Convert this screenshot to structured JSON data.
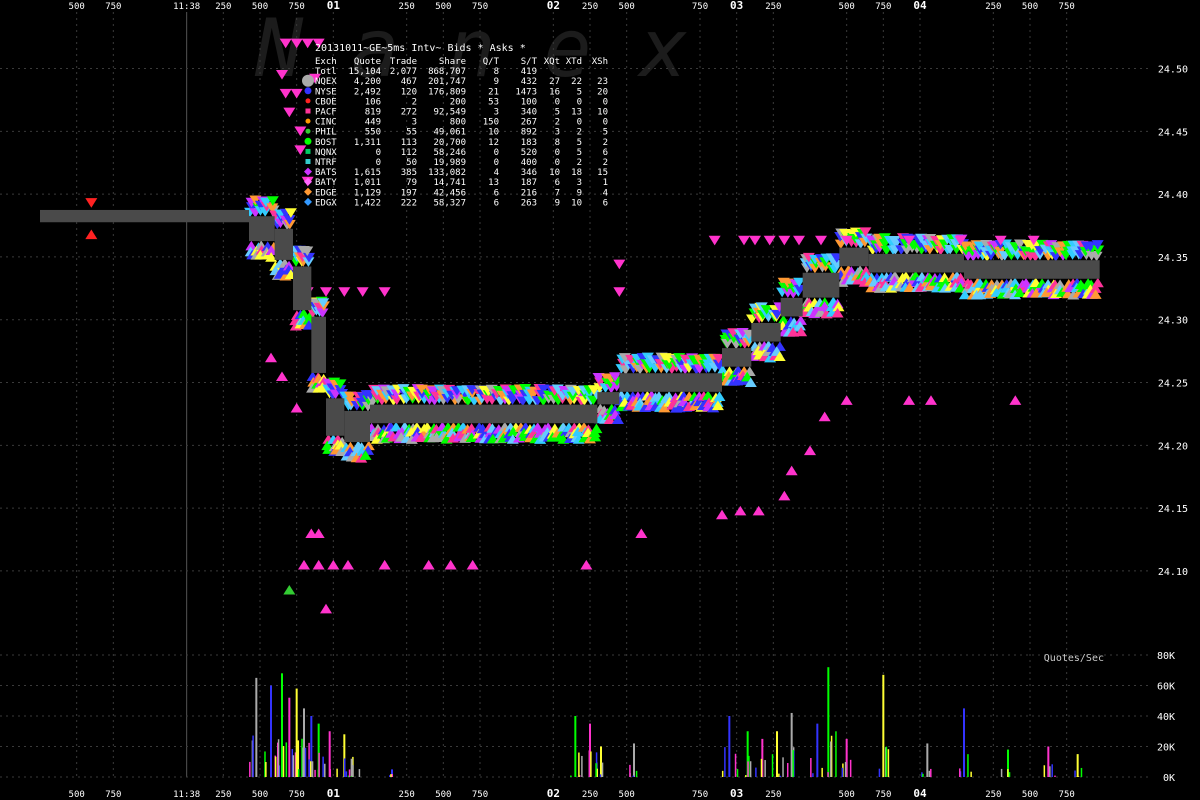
{
  "chart_data": {
    "type": "scatter",
    "title": "20131011~GE~5ms Intv~ Bids * Asks *",
    "watermark": "Nanex",
    "colors": {
      "background": "#000000",
      "grid": "#3a3a3a",
      "text": "#ffffff",
      "volume_label": "#cccccc",
      "nbbo_bar": "#4a4a4a"
    },
    "time_axis": {
      "labels_top": [
        "500",
        "750",
        "11:38",
        "250",
        "500",
        "750",
        "01",
        "250",
        "500",
        "750",
        "02",
        "250",
        "500",
        "750",
        "03",
        "250",
        "500",
        "750",
        "04",
        "250",
        "500",
        "750"
      ],
      "labels_bottom": [
        "500",
        "750",
        "11:38",
        "250",
        "500",
        "750",
        "01",
        "250",
        "500",
        "750",
        "02",
        "250",
        "500",
        "750",
        "03",
        "250",
        "500",
        "750",
        "04",
        "250",
        "500",
        "750"
      ],
      "bold_labels": [
        "01",
        "02",
        "03",
        "04"
      ],
      "ticks": [
        -5,
        -4,
        -2,
        -1,
        0,
        1,
        2,
        4,
        5,
        6,
        8,
        9,
        10,
        12,
        13,
        14,
        16,
        17,
        18,
        20,
        21,
        22
      ],
      "range": [
        -6,
        24
      ],
      "unit": "ms"
    },
    "price_axis": {
      "ticks": [
        "24.10",
        "24.15",
        "24.20",
        "24.25",
        "24.30",
        "24.35",
        "24.40",
        "24.45",
        "24.50"
      ],
      "range": [
        24.045,
        24.545
      ]
    },
    "volume_axis": {
      "label": "Quotes/Sec",
      "ticks": [
        "0K",
        "20K",
        "40K",
        "60K",
        "80K"
      ],
      "range": [
        0,
        80000
      ]
    },
    "table": {
      "columns": [
        "Exch",
        "Quote",
        "Trade",
        "Share",
        "Q/T",
        "S/T",
        "XQt",
        "XTd",
        "XSh"
      ],
      "rows": [
        {
          "cells": [
            "Totl",
            "15,104",
            "2,077",
            "868,707",
            "8",
            "419",
            "",
            "",
            ""
          ],
          "color": "#ffffff",
          "marker": "none"
        },
        {
          "cells": [
            "NQEX",
            "4,200",
            "467",
            "201,747",
            "9",
            "432",
            "27",
            "22",
            "23"
          ],
          "color": "#aaaaaa",
          "marker": "circle-large"
        },
        {
          "cells": [
            "NYSE",
            "2,492",
            "120",
            "176,809",
            "21",
            "1473",
            "16",
            "5",
            "20"
          ],
          "color": "#3333ff",
          "marker": "circle"
        },
        {
          "cells": [
            "CBOE",
            "106",
            "2",
            "200",
            "53",
            "100",
            "0",
            "0",
            "0"
          ],
          "color": "#ff2222",
          "marker": "circle-small"
        },
        {
          "cells": [
            "PACF",
            "819",
            "272",
            "92,549",
            "3",
            "340",
            "5",
            "13",
            "10"
          ],
          "color": "#ff3399",
          "marker": "square"
        },
        {
          "cells": [
            "CINC",
            "449",
            "3",
            "800",
            "150",
            "267",
            "2",
            "0",
            "0"
          ],
          "color": "#ff9900",
          "marker": "circle-small"
        },
        {
          "cells": [
            "PHIL",
            "550",
            "55",
            "49,061",
            "10",
            "892",
            "3",
            "2",
            "5"
          ],
          "color": "#33cc33",
          "marker": "circle-small"
        },
        {
          "cells": [
            "BOST",
            "1,311",
            "113",
            "20,700",
            "12",
            "183",
            "8",
            "5",
            "2"
          ],
          "color": "#00ff00",
          "marker": "circle"
        },
        {
          "cells": [
            "NQNX",
            "0",
            "112",
            "58,246",
            "0",
            "520",
            "0",
            "5",
            "6"
          ],
          "color": "#00cc66",
          "marker": "square"
        },
        {
          "cells": [
            "NTRF",
            "0",
            "50",
            "19,989",
            "0",
            "400",
            "0",
            "2",
            "2"
          ],
          "color": "#33cccc",
          "marker": "square"
        },
        {
          "cells": [
            "BATS",
            "1,615",
            "385",
            "133,082",
            "4",
            "346",
            "10",
            "18",
            "15"
          ],
          "color": "#cc33ff",
          "marker": "diamond"
        },
        {
          "cells": [
            "BATY",
            "1,011",
            "79",
            "14,741",
            "13",
            "187",
            "6",
            "3",
            "1"
          ],
          "color": "#ff66ff",
          "marker": "diamond"
        },
        {
          "cells": [
            "EDGE",
            "1,129",
            "197",
            "42,456",
            "6",
            "216",
            "7",
            "9",
            "4"
          ],
          "color": "#ff9933",
          "marker": "diamond"
        },
        {
          "cells": [
            "EDGX",
            "1,422",
            "222",
            "58,327",
            "6",
            "263",
            "9",
            "10",
            "6"
          ],
          "color": "#3399ff",
          "marker": "diamond"
        }
      ]
    },
    "nbbo_steps": [
      {
        "t0": -6.0,
        "t1": -0.3,
        "bid": 24.38,
        "ask": 24.385
      },
      {
        "t0": -0.3,
        "t1": 0.4,
        "bid": 24.365,
        "ask": 24.38
      },
      {
        "t0": 0.4,
        "t1": 0.9,
        "bid": 24.35,
        "ask": 24.37
      },
      {
        "t0": 0.9,
        "t1": 1.4,
        "bid": 24.31,
        "ask": 24.34
      },
      {
        "t0": 1.4,
        "t1": 1.8,
        "bid": 24.26,
        "ask": 24.3
      },
      {
        "t0": 1.8,
        "t1": 2.3,
        "bid": 24.21,
        "ask": 24.235
      },
      {
        "t0": 2.3,
        "t1": 3.0,
        "bid": 24.205,
        "ask": 24.225
      },
      {
        "t0": 3.0,
        "t1": 9.2,
        "bid": 24.22,
        "ask": 24.23
      },
      {
        "t0": 9.2,
        "t1": 9.8,
        "bid": 24.235,
        "ask": 24.24
      },
      {
        "t0": 9.8,
        "t1": 12.6,
        "bid": 24.245,
        "ask": 24.255
      },
      {
        "t0": 12.6,
        "t1": 13.4,
        "bid": 24.265,
        "ask": 24.275
      },
      {
        "t0": 13.4,
        "t1": 14.2,
        "bid": 24.285,
        "ask": 24.295
      },
      {
        "t0": 14.2,
        "t1": 14.8,
        "bid": 24.305,
        "ask": 24.315
      },
      {
        "t0": 14.8,
        "t1": 15.8,
        "bid": 24.32,
        "ask": 24.335
      },
      {
        "t0": 15.8,
        "t1": 16.6,
        "bid": 24.345,
        "ask": 24.355
      },
      {
        "t0": 16.6,
        "t1": 19.2,
        "bid": 24.34,
        "ask": 24.35
      },
      {
        "t0": 19.2,
        "t1": 22.9,
        "bid": 24.335,
        "ask": 24.345
      }
    ],
    "quote_points": [
      {
        "t": -4.6,
        "p": 24.393,
        "dir": "down",
        "color": "#ff2222"
      },
      {
        "t": -4.6,
        "p": 24.368,
        "dir": "up",
        "color": "#ff2222"
      },
      {
        "t": 0.7,
        "p": 24.52,
        "dir": "down",
        "color": "#ff33cc"
      },
      {
        "t": 1.0,
        "p": 24.52,
        "dir": "down",
        "color": "#ff33cc"
      },
      {
        "t": 1.3,
        "p": 24.52,
        "dir": "down",
        "color": "#ff33cc"
      },
      {
        "t": 1.6,
        "p": 24.52,
        "dir": "down",
        "color": "#ff33cc"
      },
      {
        "t": 0.6,
        "p": 24.495,
        "dir": "down",
        "color": "#ff33cc"
      },
      {
        "t": 1.5,
        "p": 24.492,
        "dir": "down",
        "color": "#ff33cc"
      },
      {
        "t": 0.7,
        "p": 24.48,
        "dir": "down",
        "color": "#ff33cc"
      },
      {
        "t": 1.0,
        "p": 24.48,
        "dir": "down",
        "color": "#ff33cc"
      },
      {
        "t": 0.8,
        "p": 24.465,
        "dir": "down",
        "color": "#ff33cc"
      },
      {
        "t": 1.1,
        "p": 24.45,
        "dir": "down",
        "color": "#ff33cc"
      },
      {
        "t": 1.1,
        "p": 24.435,
        "dir": "down",
        "color": "#ff33cc"
      },
      {
        "t": 1.3,
        "p": 24.41,
        "dir": "down",
        "color": "#ff33cc"
      },
      {
        "t": 1.2,
        "p": 24.322,
        "dir": "down",
        "color": "#ff33cc"
      },
      {
        "t": 1.3,
        "p": 24.322,
        "dir": "down",
        "color": "#ff33cc"
      },
      {
        "t": 1.8,
        "p": 24.322,
        "dir": "down",
        "color": "#ff33cc"
      },
      {
        "t": 2.3,
        "p": 24.322,
        "dir": "down",
        "color": "#ff33cc"
      },
      {
        "t": 2.8,
        "p": 24.322,
        "dir": "down",
        "color": "#ff33cc"
      },
      {
        "t": 3.4,
        "p": 24.322,
        "dir": "down",
        "color": "#ff33cc"
      },
      {
        "t": 9.8,
        "p": 24.322,
        "dir": "down",
        "color": "#ff33cc"
      },
      {
        "t": 9.8,
        "p": 24.344,
        "dir": "down",
        "color": "#ff33cc"
      },
      {
        "t": 12.4,
        "p": 24.363,
        "dir": "down",
        "color": "#ff33cc"
      },
      {
        "t": 13.2,
        "p": 24.363,
        "dir": "down",
        "color": "#ff33cc"
      },
      {
        "t": 13.5,
        "p": 24.363,
        "dir": "down",
        "color": "#ff33cc"
      },
      {
        "t": 13.9,
        "p": 24.363,
        "dir": "down",
        "color": "#ff33cc"
      },
      {
        "t": 14.3,
        "p": 24.363,
        "dir": "down",
        "color": "#ff33cc"
      },
      {
        "t": 14.7,
        "p": 24.363,
        "dir": "down",
        "color": "#ff33cc"
      },
      {
        "t": 15.3,
        "p": 24.363,
        "dir": "down",
        "color": "#ff33cc"
      },
      {
        "t": 16.0,
        "p": 24.363,
        "dir": "down",
        "color": "#ff33cc"
      },
      {
        "t": 17.7,
        "p": 24.363,
        "dir": "down",
        "color": "#ff33cc"
      },
      {
        "t": 19.1,
        "p": 24.363,
        "dir": "down",
        "color": "#ff33cc"
      },
      {
        "t": 20.2,
        "p": 24.363,
        "dir": "down",
        "color": "#ff33cc"
      },
      {
        "t": 21.1,
        "p": 24.363,
        "dir": "down",
        "color": "#ff33cc"
      },
      {
        "t": 0.3,
        "p": 24.27,
        "dir": "up",
        "color": "#ff33cc"
      },
      {
        "t": 0.6,
        "p": 24.255,
        "dir": "up",
        "color": "#ff33cc"
      },
      {
        "t": 1.0,
        "p": 24.23,
        "dir": "up",
        "color": "#ff33cc"
      },
      {
        "t": 1.4,
        "p": 24.13,
        "dir": "up",
        "color": "#ff33cc"
      },
      {
        "t": 1.6,
        "p": 24.13,
        "dir": "up",
        "color": "#ff33cc"
      },
      {
        "t": 1.2,
        "p": 24.105,
        "dir": "up",
        "color": "#ff33cc"
      },
      {
        "t": 1.6,
        "p": 24.105,
        "dir": "up",
        "color": "#ff33cc"
      },
      {
        "t": 2.0,
        "p": 24.105,
        "dir": "up",
        "color": "#ff33cc"
      },
      {
        "t": 2.4,
        "p": 24.105,
        "dir": "up",
        "color": "#ff33cc"
      },
      {
        "t": 3.4,
        "p": 24.105,
        "dir": "up",
        "color": "#ff33cc"
      },
      {
        "t": 4.6,
        "p": 24.105,
        "dir": "up",
        "color": "#ff33cc"
      },
      {
        "t": 5.2,
        "p": 24.105,
        "dir": "up",
        "color": "#ff33cc"
      },
      {
        "t": 5.8,
        "p": 24.105,
        "dir": "up",
        "color": "#ff33cc"
      },
      {
        "t": 8.9,
        "p": 24.105,
        "dir": "up",
        "color": "#ff33cc"
      },
      {
        "t": 10.4,
        "p": 24.13,
        "dir": "up",
        "color": "#ff33cc"
      },
      {
        "t": 1.8,
        "p": 24.07,
        "dir": "up",
        "color": "#ff33cc"
      },
      {
        "t": 0.8,
        "p": 24.085,
        "dir": "up",
        "color": "#33cc33"
      },
      {
        "t": 12.6,
        "p": 24.145,
        "dir": "up",
        "color": "#ff33cc"
      },
      {
        "t": 13.1,
        "p": 24.148,
        "dir": "up",
        "color": "#ff33cc"
      },
      {
        "t": 13.6,
        "p": 24.148,
        "dir": "up",
        "color": "#ff33cc"
      },
      {
        "t": 14.3,
        "p": 24.16,
        "dir": "up",
        "color": "#ff33cc"
      },
      {
        "t": 14.5,
        "p": 24.18,
        "dir": "up",
        "color": "#ff33cc"
      },
      {
        "t": 15.0,
        "p": 24.196,
        "dir": "up",
        "color": "#ff33cc"
      },
      {
        "t": 15.4,
        "p": 24.223,
        "dir": "up",
        "color": "#ff33cc"
      },
      {
        "t": 16.0,
        "p": 24.236,
        "dir": "up",
        "color": "#ff33cc"
      },
      {
        "t": 17.7,
        "p": 24.236,
        "dir": "up",
        "color": "#ff33cc"
      },
      {
        "t": 18.3,
        "p": 24.236,
        "dir": "up",
        "color": "#ff33cc"
      },
      {
        "t": 20.6,
        "p": 24.236,
        "dir": "up",
        "color": "#ff33cc"
      }
    ],
    "volume_spikes": [
      {
        "t": -0.1,
        "v": 65000
      },
      {
        "t": 0.3,
        "v": 60000
      },
      {
        "t": 0.6,
        "v": 68000
      },
      {
        "t": 0.8,
        "v": 52000
      },
      {
        "t": 1.0,
        "v": 58000
      },
      {
        "t": 1.2,
        "v": 45000
      },
      {
        "t": 1.4,
        "v": 40000
      },
      {
        "t": 1.6,
        "v": 35000
      },
      {
        "t": 1.9,
        "v": 30000
      },
      {
        "t": 2.3,
        "v": 28000
      },
      {
        "t": 2.5,
        "v": 12000
      },
      {
        "t": 3.6,
        "v": 5000
      },
      {
        "t": 8.6,
        "v": 40000
      },
      {
        "t": 9.0,
        "v": 35000
      },
      {
        "t": 9.3,
        "v": 20000
      },
      {
        "t": 10.2,
        "v": 22000
      },
      {
        "t": 12.8,
        "v": 40000
      },
      {
        "t": 13.3,
        "v": 30000
      },
      {
        "t": 13.7,
        "v": 25000
      },
      {
        "t": 14.1,
        "v": 30000
      },
      {
        "t": 14.5,
        "v": 42000
      },
      {
        "t": 15.2,
        "v": 35000
      },
      {
        "t": 15.5,
        "v": 72000
      },
      {
        "t": 16.0,
        "v": 25000
      },
      {
        "t": 17.0,
        "v": 67000
      },
      {
        "t": 18.2,
        "v": 22000
      },
      {
        "t": 19.2,
        "v": 45000
      },
      {
        "t": 20.4,
        "v": 18000
      },
      {
        "t": 21.5,
        "v": 20000
      },
      {
        "t": 22.3,
        "v": 15000
      }
    ]
  }
}
